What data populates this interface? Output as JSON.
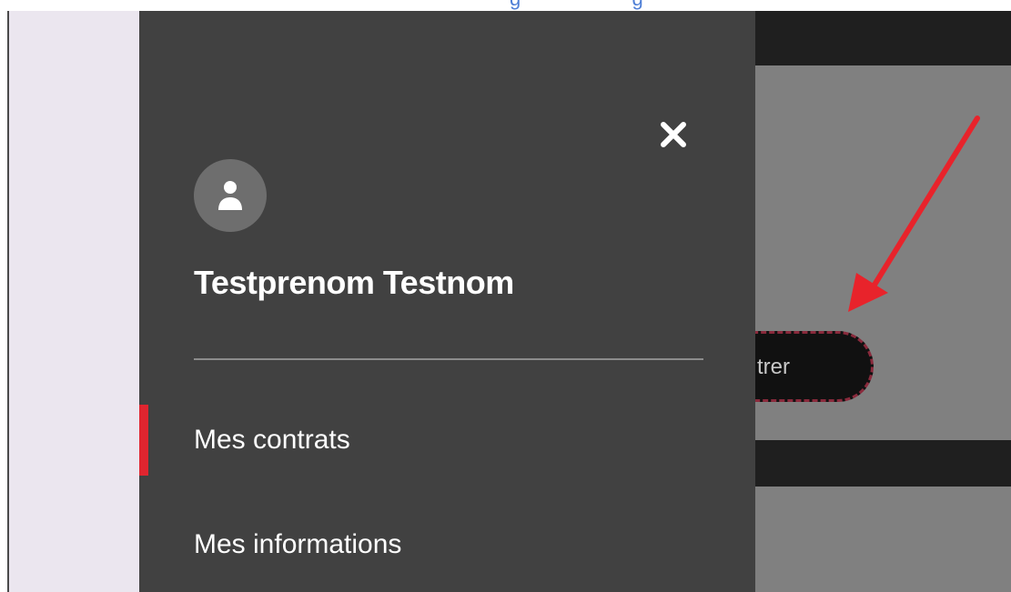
{
  "doc_heading_fragment": "g                    g",
  "background": {
    "button_label": "trer"
  },
  "drawer": {
    "user_name": "Testprenom Testnom",
    "nav_items": [
      {
        "label": "Mes contrats",
        "active": true
      },
      {
        "label": "Mes informations",
        "active": false
      }
    ]
  },
  "icons": {
    "close": "close-icon",
    "avatar": "user-icon",
    "annotation": "red-arrow-icon"
  },
  "colors": {
    "drawer_bg": "#414141",
    "active_indicator": "#e0252f",
    "annotation_arrow": "#e8232b",
    "button_outline": "#8a2a3c"
  }
}
